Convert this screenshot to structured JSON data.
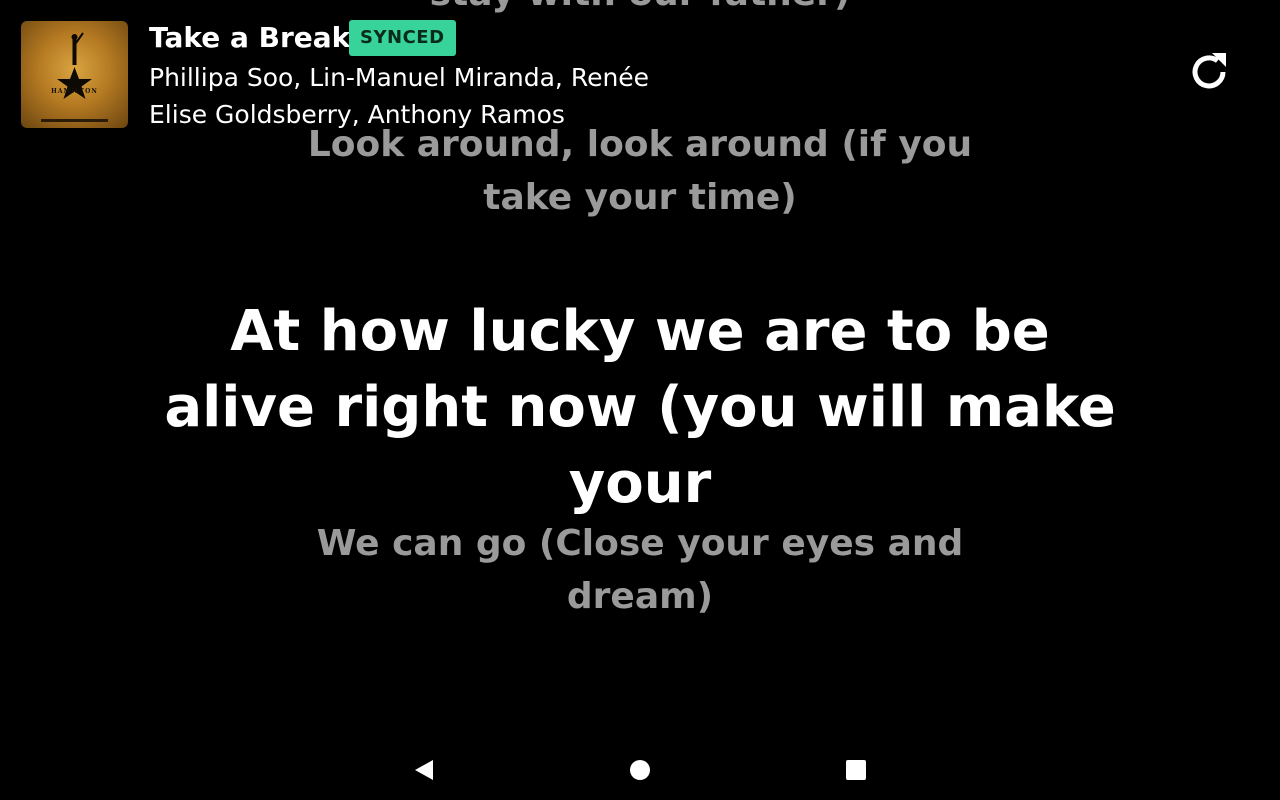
{
  "app": {
    "header": {
      "song_title": "Take a Break",
      "sync_badge": "SYNCED",
      "artists": "Phillipa Soo, Lin-Manuel Miranda, Renée Elise Goldsberry, Anthony Ramos",
      "album_art_text": "HAMILTON",
      "refresh_icon": "refresh-icon"
    },
    "lyrics": {
      "previous_top": "stay with our father)",
      "previous": "Look around, look around (if you take your time)",
      "current": "At how lucky we are to be alive right now (you will make your",
      "next": "We can go (Close your eyes and dream)"
    },
    "colors": {
      "background": "#000000",
      "active_lyric": "#ffffff",
      "inactive_lyric": "#9a9a9a",
      "badge_bg": "#37d39a",
      "badge_text": "#0a2a1c"
    }
  },
  "navbar": {
    "back_icon": "back-triangle-icon",
    "home_icon": "home-circle-icon",
    "recents_icon": "recents-square-icon"
  }
}
